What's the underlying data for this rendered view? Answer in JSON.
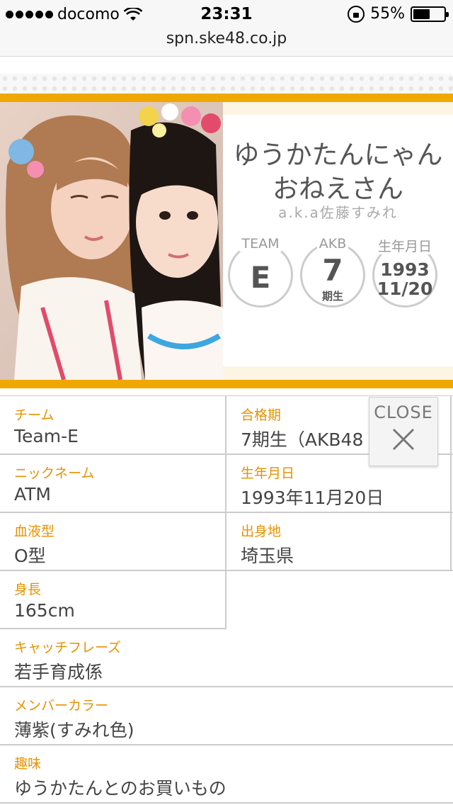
{
  "status_bar": {
    "carrier": "docomo",
    "time": "23:31",
    "battery": "55%",
    "battery_level": 0.55
  },
  "browser": {
    "url": "spn.ske48.co.jp"
  },
  "profile": {
    "nickname_line1": "ゆうかたんにゃん",
    "nickname_line2": "おねえさん",
    "aka": "a.k.a佐藤すみれ",
    "badges": {
      "team_label": "TEAM",
      "team_value": "E",
      "akb_label": "AKB",
      "akb_value": "7",
      "akb_sub": "期生",
      "birth_label": "生年月日",
      "birth_year": "1993",
      "birth_md": "11/20"
    }
  },
  "info": {
    "team_label": "チーム",
    "team_value": "Team-E",
    "generation_label": "合格期",
    "generation_value": "7期生（AKB48",
    "nickname_label": "ニックネーム",
    "nickname_value": "ATM",
    "birthday_label": "生年月日",
    "birthday_value": "1993年11月20日",
    "blood_label": "血液型",
    "blood_value": "O型",
    "birthplace_label": "出身地",
    "birthplace_value": "埼玉県",
    "height_label": "身長",
    "height_value": "165cm",
    "catchphrase_label": "キャッチフレーズ",
    "catchphrase_value": "若手育成係",
    "color_label": "メンバーカラー",
    "color_value": "薄紫(すみれ色)",
    "hobby_label": "趣味",
    "hobby_value": "ゆうかたんとのお買いもの"
  },
  "close_button": {
    "label": "CLOSE"
  },
  "colors": {
    "accent_orange": "#f0a800",
    "label_orange": "#e69200"
  }
}
